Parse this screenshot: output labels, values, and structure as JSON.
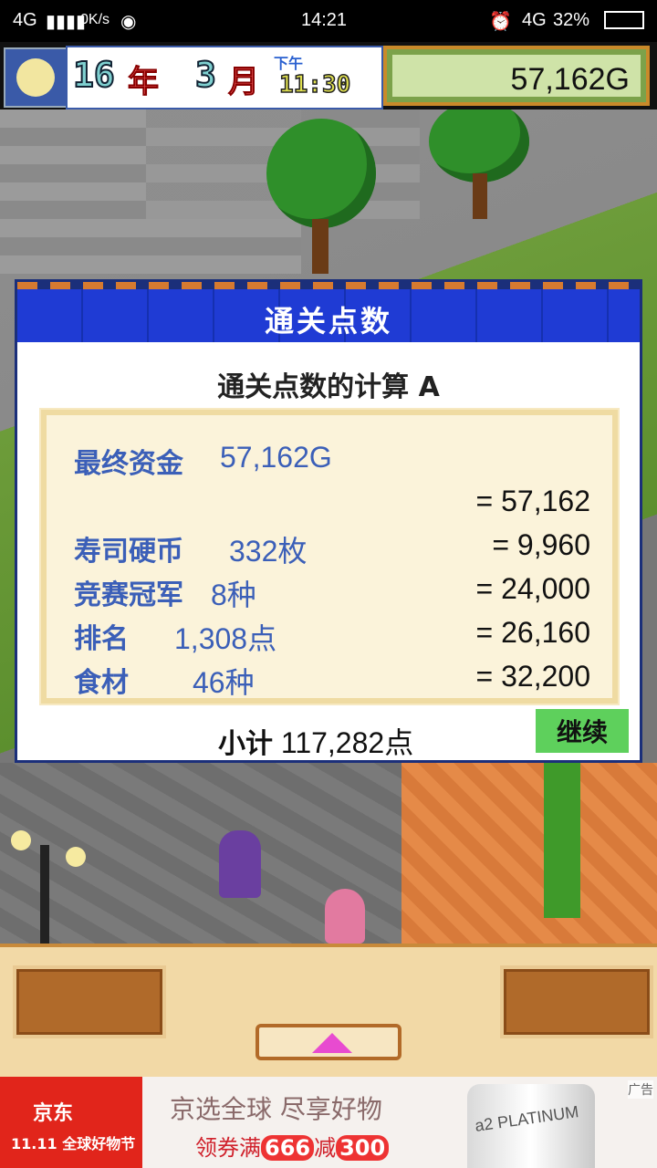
{
  "status_bar": {
    "network": "4G",
    "speed": "0K/s",
    "time": "14:21",
    "net_right": "4G",
    "battery": "32%"
  },
  "header": {
    "year": "16",
    "year_unit": "年",
    "month": "3",
    "month_unit": "月",
    "ampm": "下午",
    "clock": "11:30",
    "money": "57,162G",
    "coins": "332"
  },
  "dialog": {
    "title": "通关点数",
    "calc_title": "通关点数的计算 A",
    "rows": [
      {
        "label": "最终资金",
        "value": "57,162G",
        "result": ""
      },
      {
        "label": "",
        "value": "",
        "result": "= 57,162"
      },
      {
        "label": "寿司硬币",
        "value": "332枚",
        "result": "= 9,960"
      },
      {
        "label": "竞赛冠军",
        "value": "8种",
        "result": "= 24,000"
      },
      {
        "label": "排名",
        "value": "1,308点",
        "result": "= 26,160"
      },
      {
        "label": "食材",
        "value": "46种",
        "result": "= 32,200"
      }
    ],
    "subtotal_label": "小计",
    "subtotal_value": "117,282点",
    "continue_label": "继续"
  },
  "ad": {
    "brand": "京东",
    "fest": "全球好物节",
    "fest_prefix": "11.11",
    "headline": "京选全球 尽享好物",
    "promo_a": "领券满",
    "promo_b": "666",
    "promo_c": "减",
    "promo_d": "300",
    "tag": "广告",
    "product": "a2 PLATINUM"
  }
}
